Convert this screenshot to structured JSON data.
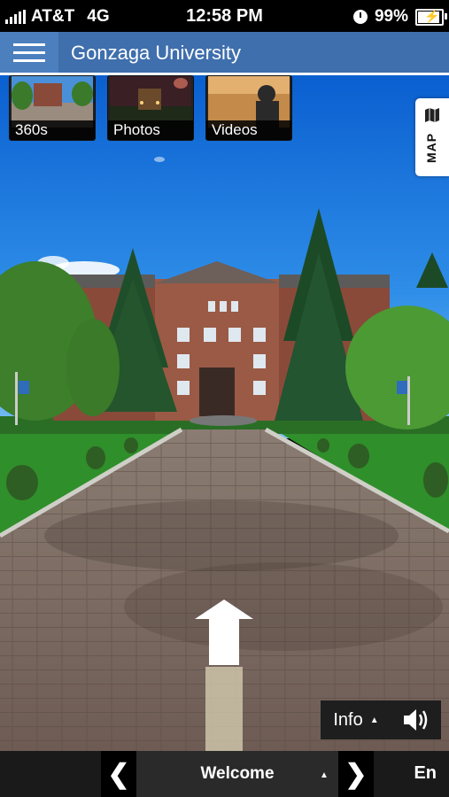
{
  "status_bar": {
    "carrier": "AT&T",
    "network": "4G",
    "time": "12:58 PM",
    "battery": "99%",
    "battery_level": 0.99
  },
  "header": {
    "title": "Gonzaga University",
    "menu_icon": "hamburger-icon"
  },
  "media_tabs": [
    {
      "label": "360s"
    },
    {
      "label": "Photos"
    },
    {
      "label": "Videos"
    }
  ],
  "map_tab": {
    "label": "MAP",
    "icon": "map-icon"
  },
  "controls": {
    "info_label": "Info",
    "info_caret": "▲",
    "sound_icon": "speaker-icon"
  },
  "bottom_nav": {
    "prev_glyph": "❮",
    "next_glyph": "❯",
    "current_stop": "Welcome",
    "stop_caret": "▲",
    "language": "En"
  },
  "colors": {
    "header": "#3f6fad",
    "menu_button": "#4c7fbe"
  }
}
